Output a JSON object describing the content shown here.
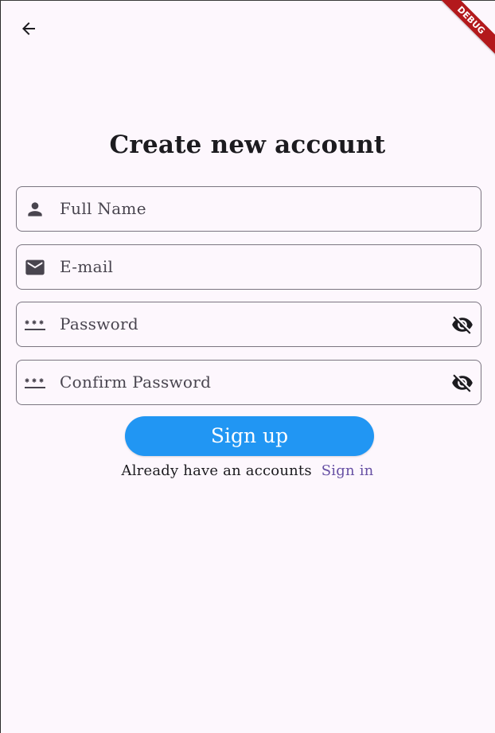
{
  "app_bar": {
    "back_icon": "arrow-back-icon",
    "debug_label": "DEBUG",
    "debug_color": "#b3191c"
  },
  "page": {
    "title": "Create new account"
  },
  "form": {
    "fields": [
      {
        "placeholder": "Full Name",
        "icon": "person-icon",
        "trailing_icon": null
      },
      {
        "placeholder": "E-mail",
        "icon": "mail-icon",
        "trailing_icon": null
      },
      {
        "placeholder": "Password",
        "icon": "password-icon",
        "trailing_icon": "visibility-off-icon"
      },
      {
        "placeholder": "Confirm Password",
        "icon": "password-icon",
        "trailing_icon": "visibility-off-icon"
      }
    ],
    "submit_label": "Sign up",
    "submit_color": "#2196f3"
  },
  "footer": {
    "prompt": "Already have an accounts",
    "link_label": "Sign in",
    "link_color": "#6750a4"
  },
  "colors": {
    "background": "#fdf7fd",
    "field_border": "#7a7580",
    "text_primary": "#1c1b1f",
    "text_secondary": "#49454f"
  }
}
